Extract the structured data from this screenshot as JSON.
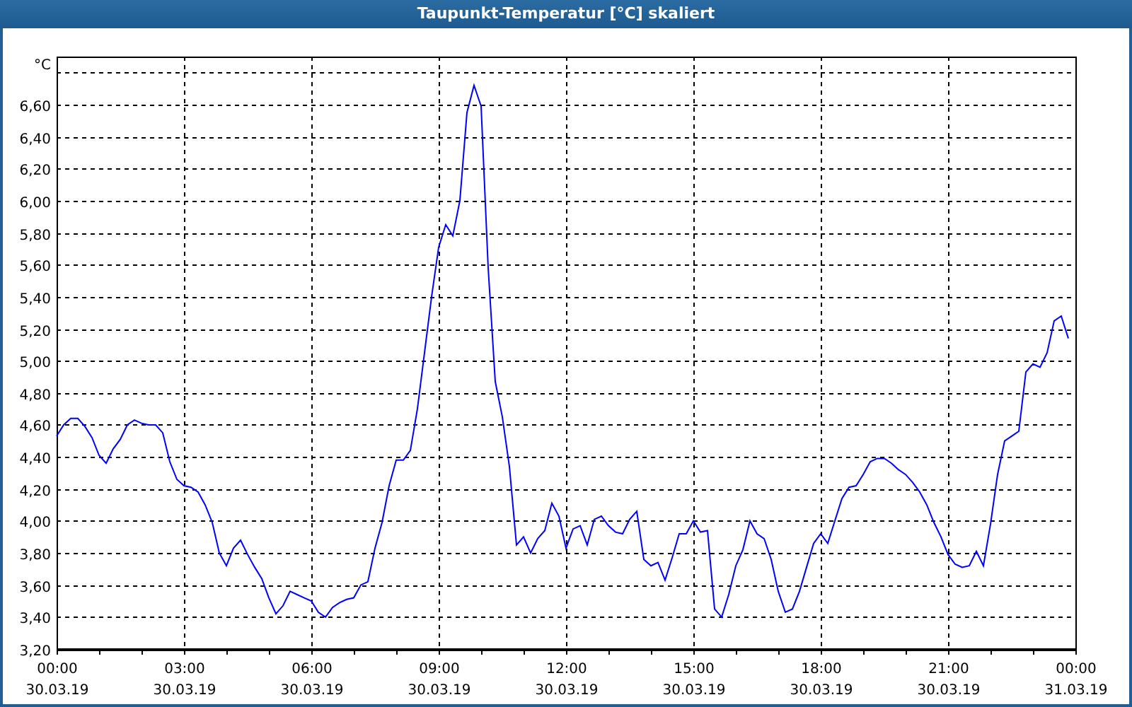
{
  "window": {
    "title": "Taupunkt-Temperatur [°C] skaliert"
  },
  "chart": {
    "chart_data": {
      "type": "line",
      "grid": true,
      "ylabel": "°C",
      "ylim": [
        3.2,
        6.9
      ],
      "categories": [
        "00:00\n30.03.19",
        null,
        null,
        null,
        null,
        null,
        null,
        null,
        null,
        null,
        null,
        null,
        null,
        null,
        null,
        null,
        null,
        null,
        "03:00\n30.03.19",
        null,
        null,
        null,
        null,
        null,
        null,
        null,
        null,
        null,
        null,
        null,
        null,
        null,
        null,
        null,
        null,
        null,
        "06:00\n30.03.19",
        null,
        null,
        null,
        null,
        null,
        null,
        null,
        null,
        null,
        null,
        null,
        null,
        null,
        null,
        null,
        null,
        null,
        "09:00\n30.03.19",
        null,
        null,
        null,
        null,
        null,
        null,
        null,
        null,
        null,
        null,
        null,
        null,
        null,
        null,
        null,
        null,
        null,
        "12:00\n30.03.19",
        null,
        null,
        null,
        null,
        null,
        null,
        null,
        null,
        null,
        null,
        null,
        null,
        null,
        null,
        null,
        null,
        null,
        "15:00\n30.03.19",
        null,
        null,
        null,
        null,
        null,
        null,
        null,
        null,
        null,
        null,
        null,
        null,
        null,
        null,
        null,
        null,
        null,
        "18:00\n30.03.19",
        null,
        null,
        null,
        null,
        null,
        null,
        null,
        null,
        null,
        null,
        null,
        null,
        null,
        null,
        null,
        null,
        null,
        "21:00\n30.03.19",
        null,
        null,
        null,
        null,
        null,
        null,
        null,
        null,
        null,
        null,
        null,
        null,
        null,
        null,
        null,
        null,
        null,
        "00:00\n31.03.19"
      ],
      "yticks": [
        {
          "value": 3.2,
          "label": "3,20"
        },
        {
          "value": 3.4,
          "label": "3,40"
        },
        {
          "value": 3.6,
          "label": "3,60"
        },
        {
          "value": 3.8,
          "label": "3,80"
        },
        {
          "value": 4.0,
          "label": "4,00"
        },
        {
          "value": 4.2,
          "label": "4,20"
        },
        {
          "value": 4.4,
          "label": "4,40"
        },
        {
          "value": 4.6,
          "label": "4,60"
        },
        {
          "value": 4.8,
          "label": "4,80"
        },
        {
          "value": 5.0,
          "label": "5,00"
        },
        {
          "value": 5.2,
          "label": "5,20"
        },
        {
          "value": 5.4,
          "label": "5,40"
        },
        {
          "value": 5.6,
          "label": "5,60"
        },
        {
          "value": 5.8,
          "label": "5,80"
        },
        {
          "value": 6.0,
          "label": "6,00"
        },
        {
          "value": 6.2,
          "label": "6,20"
        },
        {
          "value": 6.4,
          "label": "6,40"
        },
        {
          "value": 6.6,
          "label": "6,60"
        }
      ],
      "series": [
        {
          "color": "#0000ff",
          "values": [
            4.53,
            4.6,
            4.64,
            4.64,
            4.59,
            4.52,
            4.41,
            4.36,
            4.45,
            4.51,
            4.6,
            4.63,
            4.61,
            4.6,
            4.6,
            4.55,
            4.37,
            4.26,
            4.22,
            4.21,
            4.18,
            4.1,
            3.99,
            3.8,
            3.72,
            3.83,
            3.88,
            3.79,
            3.71,
            3.64,
            3.52,
            3.42,
            3.47,
            3.56,
            3.54,
            3.52,
            3.5,
            3.43,
            3.4,
            3.46,
            3.49,
            3.51,
            3.52,
            3.6,
            3.62,
            3.83,
            3.99,
            4.22,
            4.38,
            4.38,
            4.44,
            4.7,
            5.05,
            5.4,
            5.71,
            5.85,
            5.78,
            6.0,
            6.55,
            6.72,
            6.59,
            5.58,
            4.87,
            4.65,
            4.34,
            3.85,
            3.9,
            3.8,
            3.89,
            3.94,
            4.11,
            4.03,
            3.83,
            3.95,
            3.97,
            3.85,
            4.01,
            4.03,
            3.97,
            3.93,
            3.92,
            4.01,
            4.06,
            3.76,
            3.72,
            3.74,
            3.63,
            3.77,
            3.92,
            3.92,
            4.0,
            3.93,
            3.94,
            3.45,
            3.4,
            3.54,
            3.72,
            3.82,
            4.0,
            3.92,
            3.89,
            3.76,
            3.56,
            3.43,
            3.45,
            3.56,
            3.71,
            3.86,
            3.92,
            3.86,
            4.0,
            4.14,
            4.21,
            4.22,
            4.29,
            4.37,
            4.39,
            4.39,
            4.36,
            4.32,
            4.29,
            4.24,
            4.18,
            4.1,
            3.99,
            3.9,
            3.79,
            3.73,
            3.71,
            3.72,
            3.81,
            3.72,
            3.98,
            4.29,
            4.5,
            4.53,
            4.56,
            4.93,
            4.98,
            4.96,
            5.05,
            5.25,
            5.28,
            5.14,
            null
          ]
        }
      ]
    }
  }
}
